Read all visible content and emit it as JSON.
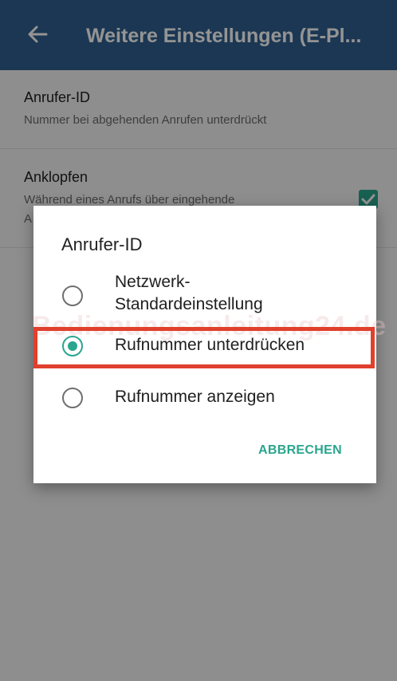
{
  "toolbar": {
    "title": "Weitere Einstellungen (E-Pl...",
    "back_icon": "arrow-left-icon",
    "background": "#2f5f8f"
  },
  "settings": {
    "caller_id": {
      "title": "Anrufer-ID",
      "summary": "Nummer bei abgehenden Anrufen unterdrückt"
    },
    "call_waiting": {
      "title": "Anklopfen",
      "summary": "Während eines Anrufs über eingehende",
      "summary_line2": "A",
      "checked": true
    }
  },
  "dialog": {
    "title": "Anrufer-ID",
    "options": [
      {
        "label_line1": "Netzwerk-",
        "label_line2": "Standardeinstellung",
        "selected": false
      },
      {
        "label": "Rufnummer unterdrücken",
        "selected": true
      },
      {
        "label": "Rufnummer anzeigen",
        "selected": false
      }
    ],
    "cancel_label": "ABBRECHEN"
  },
  "watermark": "Bedienungsanleitung24.de",
  "colors": {
    "accent": "#2aa58e",
    "highlight": "#e0402c"
  }
}
